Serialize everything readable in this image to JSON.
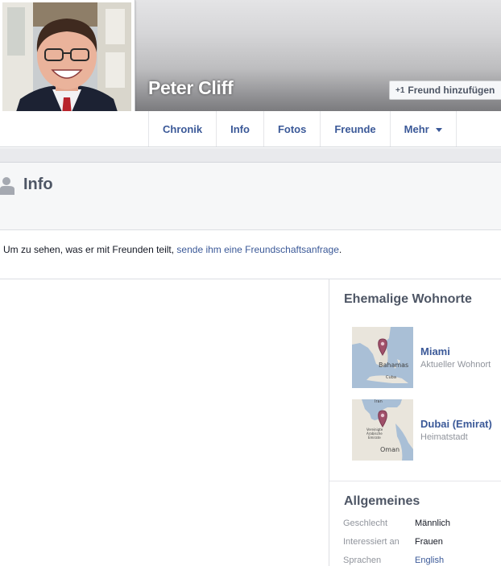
{
  "profile": {
    "name": "Peter Cliff",
    "add_friend_label": "Freund hinzufügen"
  },
  "nav": {
    "tabs": [
      "Chronik",
      "Info",
      "Fotos",
      "Freunde",
      "Mehr"
    ]
  },
  "info": {
    "title": "Info",
    "notice_text": "Um zu sehen, was er mit Freunden teilt, ",
    "notice_link": "sende ihm eine Freundschaftsanfrage",
    "notice_end": "."
  },
  "places": {
    "title": "Ehemalige Wohnorte",
    "items": [
      {
        "name": "Miami",
        "subtitle": "Aktueller Wohnort",
        "map_labels": [
          "Bahamas",
          "Cuba"
        ]
      },
      {
        "name": "Dubai (Emirat)",
        "subtitle": "Heimatstadt",
        "map_labels": [
          "Vereinigte Arabische Emirate",
          "Oman",
          "Iran"
        ]
      }
    ]
  },
  "general": {
    "title": "Allgemeines",
    "rows": [
      {
        "label": "Geschlecht",
        "value": "Männlich"
      },
      {
        "label": "Interessiert an",
        "value": "Frauen"
      },
      {
        "label": "Sprachen",
        "value": "English"
      }
    ]
  },
  "colors": {
    "link": "#3b5998",
    "muted": "#90949c",
    "heading": "#4e5665",
    "pin": "#a0506a"
  }
}
